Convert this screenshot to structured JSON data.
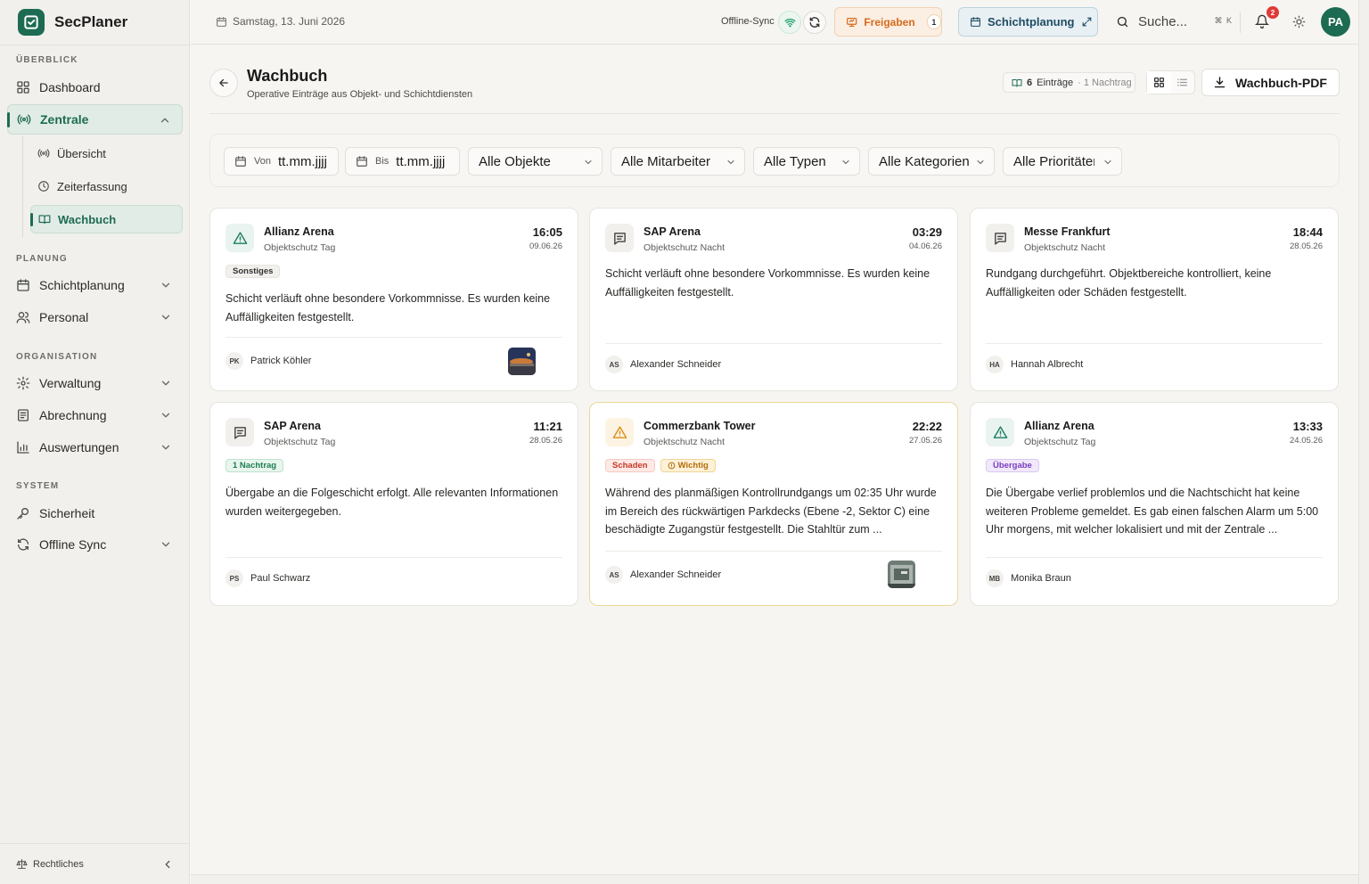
{
  "app": {
    "name": "SecPlaner"
  },
  "sidebar": {
    "sections": [
      {
        "title": "ÜBERBLICK"
      },
      {
        "title": "PLANUNG"
      },
      {
        "title": "ORGANISATION"
      },
      {
        "title": "SYSTEM"
      }
    ],
    "items": {
      "dashboard": "Dashboard",
      "zentrale": "Zentrale",
      "uebersicht": "Übersicht",
      "zeiterfassung": "Zeiterfassung",
      "wachbuch": "Wachbuch",
      "schichtplanung": "Schichtplanung",
      "personal": "Personal",
      "verwaltung": "Verwaltung",
      "abrechnung": "Abrechnung",
      "auswertungen": "Auswertungen",
      "sicherheit": "Sicherheit",
      "offline_sync": "Offline Sync"
    },
    "footer": {
      "legal": "Rechtliches"
    }
  },
  "topbar": {
    "date": "Samstag, 13. Juni 2026",
    "offline_label": "Offline-Sync",
    "freigaben": {
      "label": "Freigaben",
      "count": "1"
    },
    "schichtplanung": "Schichtplanung",
    "search": {
      "placeholder": "Suche...",
      "shortcut": "⌘ K"
    },
    "notifications_count": "2",
    "user_initials": "PA"
  },
  "page": {
    "title": "Wachbuch",
    "subtitle": "Operative Einträge aus Objekt- und Schichtdiensten",
    "entries_count": "6",
    "entries_label": "Einträge",
    "nachtrag_label": "· 1 Nachtrag",
    "pdf_button": "Wachbuch-PDF"
  },
  "filters": {
    "von_label": "Von",
    "von_value": "tt.mm.jjjj",
    "bis_label": "Bis",
    "bis_value": "tt.mm.jjjj",
    "objekte": "Alle Objekte",
    "mitarbeiter": "Alle Mitarbeiter",
    "typen": "Alle Typen",
    "kategorien": "Alle Kategorien",
    "prioritaeten": "Alle Prioritäten"
  },
  "entries": [
    {
      "object": "Allianz Arena",
      "service": "Objektschutz Tag",
      "time": "16:05",
      "date": "09.06.26",
      "icon": "warning-triangle-icon",
      "badges": [
        "Sonstiges"
      ],
      "text": "Schicht verläuft ohne besondere Vorkommnisse. Es wurden keine Auffälligkeiten festgestellt.",
      "initials": "PK",
      "author": "Patrick Köhler",
      "has_photo": true
    },
    {
      "object": "SAP Arena",
      "service": "Objektschutz Nacht",
      "time": "03:29",
      "date": "04.06.26",
      "icon": "message-icon",
      "badges": [],
      "text": "Schicht verläuft ohne besondere Vorkommnisse. Es wurden keine Auffälligkeiten festgestellt.",
      "initials": "AS",
      "author": "Alexander Schneider",
      "has_photo": false
    },
    {
      "object": "Messe Frankfurt",
      "service": "Objektschutz Nacht",
      "time": "18:44",
      "date": "28.05.26",
      "icon": "message-icon",
      "badges": [],
      "text": "Rundgang durchgeführt. Objektbereiche kontrolliert, keine Auffälligkeiten oder Schäden festgestellt.",
      "initials": "HA",
      "author": "Hannah Albrecht",
      "has_photo": false
    },
    {
      "object": "SAP Arena",
      "service": "Objektschutz Tag",
      "time": "11:21",
      "date": "28.05.26",
      "icon": "message-icon",
      "badges": [
        "1 Nachtrag"
      ],
      "text": "Übergabe an die Folgeschicht erfolgt. Alle relevanten Informationen wurden weitergegeben.",
      "initials": "PS",
      "author": "Paul Schwarz",
      "has_photo": false
    },
    {
      "object": "Commerzbank Tower",
      "service": "Objektschutz Nacht",
      "time": "22:22",
      "date": "27.05.26",
      "icon": "warning-triangle-icon",
      "badges": [
        "Schaden",
        "Wichtig"
      ],
      "text": "Während des planmäßigen Kontrollrundgangs um 02:35 Uhr wurde im Bereich des rückwärtigen Parkdecks (Ebene -2, Sektor C) eine beschädigte Zugangstür festgestellt. Die Stahltür zum ...",
      "initials": "AS",
      "author": "Alexander Schneider",
      "has_photo": true
    },
    {
      "object": "Allianz Arena",
      "service": "Objektschutz Tag",
      "time": "13:33",
      "date": "24.05.26",
      "icon": "warning-triangle-icon",
      "badges": [
        "Übergabe"
      ],
      "text": "Die Übergabe verlief problemlos und die Nachtschicht hat keine weiteren Probleme gemeldet. Es gab einen falschen Alarm um 5:00 Uhr morgens, mit welcher lokalisiert und mit der Zentrale ...",
      "initials": "MB",
      "author": "Monika Braun",
      "has_photo": false
    }
  ],
  "colors": {
    "brand": "#1d6b52",
    "accent_orange": "#d56a1c",
    "highlight_border": "#ecd79a",
    "danger": "#e03a3a"
  }
}
